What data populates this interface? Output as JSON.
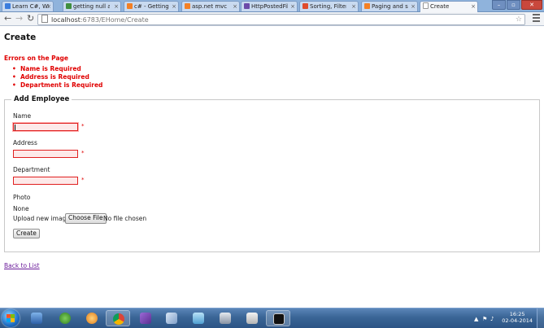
{
  "browser": {
    "tabs": [
      {
        "label": "Learn C#, WPF",
        "color": "#3b7ddd"
      },
      {
        "label": "getting null as h",
        "color": "#3f8f3f"
      },
      {
        "label": "c# - Getting the",
        "color": "#f48024"
      },
      {
        "label": "asp.net mvc - U",
        "color": "#f48024"
      },
      {
        "label": "HttpPostedFileB",
        "color": "#6c4ba8"
      },
      {
        "label": "Sorting, Filtering",
        "color": "#e04b2c"
      },
      {
        "label": "Paging and sort",
        "color": "#f48024"
      },
      {
        "label": "Create",
        "color": "#ffffff"
      }
    ],
    "active_tab": 7,
    "url_host": "localhost",
    "url_rest": ":6783/EHome/Create",
    "back_icon": "arrow-left-icon",
    "forward_icon": "arrow-right-icon",
    "reload_icon": "reload-icon"
  },
  "page": {
    "title": "Create",
    "errors_title": "Errors on the Page",
    "errors": [
      "Name is Required",
      "Address is Required",
      "Department is Required"
    ],
    "legend": "Add Employee",
    "name_label": "Name",
    "name_value": "",
    "address_label": "Address",
    "address_value": "",
    "department_label": "Department",
    "department_value": "",
    "required_mark": "*",
    "photo_label": "Photo",
    "photo_none": "None",
    "upload_label": "Upload new image:",
    "choose_file": "Choose File",
    "no_file": "No file chosen",
    "create_button": "Create",
    "back_link": "Back to List"
  },
  "taskbar": {
    "time": "16:25",
    "date": "02-04-2014",
    "apps": [
      "explorer-icon",
      "frog-icon",
      "media-icon",
      "chrome-icon",
      "visual-studio-icon",
      "tools-icon",
      "notepad-icon",
      "network-icon",
      "terminal-icon",
      "cmd-icon"
    ]
  },
  "colors": {
    "error": "#e00000",
    "input_error_bg": "#fde9e9",
    "link_visited": "#6a1b9a"
  }
}
